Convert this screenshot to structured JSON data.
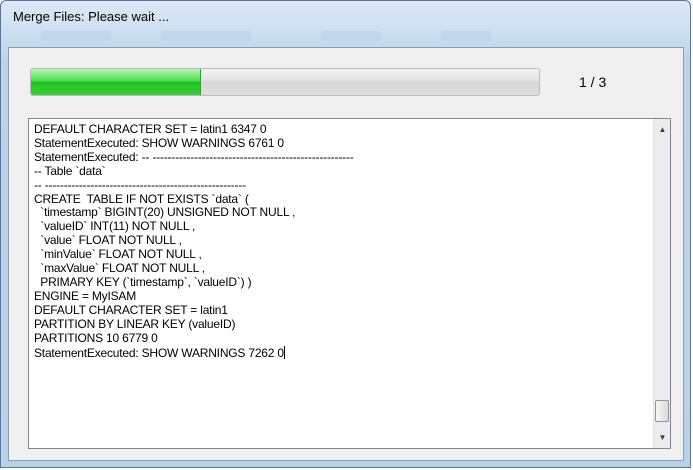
{
  "window": {
    "title": "Merge Files: Please wait ..."
  },
  "progress": {
    "fraction": 0.333,
    "count_label": "1 / 3",
    "fill_color": "#2ec92e"
  },
  "log": {
    "lines": [
      "DEFAULT CHARACTER SET = latin1 6347 0",
      "StatementExecuted: SHOW WARNINGS 6761 0",
      "StatementExecuted: -- -----------------------------------------------------",
      "-- Table `data`",
      "-- -----------------------------------------------------",
      "CREATE  TABLE IF NOT EXISTS `data` (",
      "  `timestamp` BIGINT(20) UNSIGNED NOT NULL ,",
      "  `valueID` INT(11) NOT NULL ,",
      "  `value` FLOAT NOT NULL ,",
      "  `minValue` FLOAT NOT NULL ,",
      "  `maxValue` FLOAT NOT NULL ,",
      "  PRIMARY KEY (`timestamp`, `valueID`) )",
      "ENGINE = MyISAM",
      "DEFAULT CHARACTER SET = latin1",
      "PARTITION BY LINEAR KEY (valueID)",
      "PARTITIONS 10 6779 0",
      "StatementExecuted: SHOW WARNINGS 7262 0"
    ]
  },
  "scrollbar": {
    "up_icon": "scroll-up-arrow-icon",
    "down_icon": "scroll-down-arrow-icon",
    "position_fraction": 0.95
  }
}
